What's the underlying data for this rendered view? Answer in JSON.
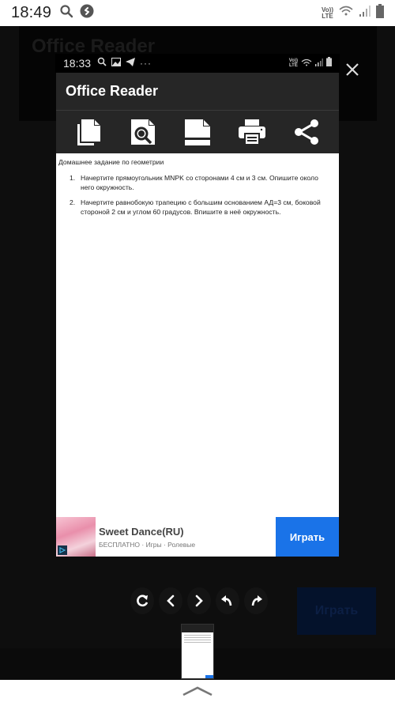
{
  "status_bar": {
    "time": "18:49",
    "left_icons": [
      "search-icon",
      "shazam-icon"
    ],
    "network_label_top": "Vo))",
    "network_label_bottom": "LTE",
    "right_icons": [
      "wifi-icon",
      "signal-icon",
      "battery-icon"
    ]
  },
  "background_app": {
    "title": "Office Reader",
    "ad_button_label": "Играть"
  },
  "inner_screenshot": {
    "status_bar": {
      "time": "18:33",
      "left_icons": [
        "search-icon",
        "image-icon",
        "telegram-icon",
        "more-icon"
      ],
      "network_label_top": "Vo))",
      "network_label_bottom": "LTE",
      "right_icons": [
        "wifi-icon",
        "signal-icon",
        "battery-icon"
      ]
    },
    "app": {
      "title": "Office Reader",
      "toolbar": [
        {
          "name": "pages-button",
          "icon": "copy-pages-icon"
        },
        {
          "name": "find-button",
          "icon": "document-search-icon"
        },
        {
          "name": "view-mode-button",
          "icon": "page-layout-icon"
        },
        {
          "name": "print-button",
          "icon": "printer-icon"
        },
        {
          "name": "share-button",
          "icon": "share-icon"
        }
      ],
      "document": {
        "heading": "Домашнее задание по геометрии",
        "items": [
          {
            "number": "1.",
            "text": "Начертите прямоугольник  MNPK со сторонами 4 см и 3 см. Опишите около него окружность."
          },
          {
            "number": "2.",
            "text": "Начертите равнобокую трапецию с большим основанием АД=3 см, боковой стороной 2 см и углом 60 градусов. Впишите  в неё окружность."
          }
        ]
      },
      "ad": {
        "title": "Sweet Dance(RU)",
        "subtitle": "БЕСПЛАТНО · Игры · Ролевые",
        "button_label": "Играть",
        "button_color": "#1a73e8"
      }
    }
  },
  "editor_controls": [
    {
      "name": "rotate-button",
      "icon": "rotate-icon"
    },
    {
      "name": "previous-button",
      "icon": "chevron-left-icon"
    },
    {
      "name": "next-button",
      "icon": "chevron-right-icon"
    },
    {
      "name": "undo-button",
      "icon": "undo-icon"
    },
    {
      "name": "redo-button",
      "icon": "redo-icon"
    }
  ],
  "close_icon": "close-icon",
  "bottom_handle_icon": "chevron-up-icon"
}
